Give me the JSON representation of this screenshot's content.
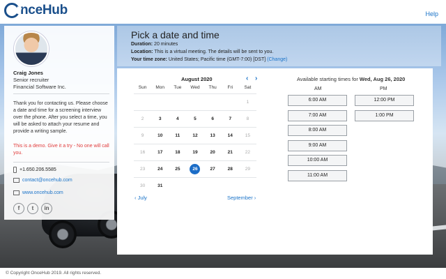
{
  "header": {
    "logo_text": "nceHub",
    "help_label": "Help"
  },
  "profile": {
    "name": "Craig Jones",
    "role": "Senior recruiter",
    "company": "Financial Software Inc.",
    "message": "Thank you for contacting us. Please choose a date and time for a screening interview over the phone. After you select a time, you will be asked to attach your resume and provide a writing sample.",
    "demo_note": "This is a demo. Give it a try - No one will call you.",
    "phone": "+1.650.206.5585",
    "email": "contact@oncehub.com",
    "website": "www.oncehub.com",
    "social": [
      "f",
      "t",
      "in"
    ]
  },
  "booking": {
    "title": "Pick a date and time",
    "duration_label": "Duration:",
    "duration_value": " 20 minutes",
    "location_label": "Location:",
    "location_value": " This is a virtual meeting. The details will be sent to you.",
    "timezone_label": "Your time zone:",
    "timezone_value": " United States;  Pacific time  (GMT-7:00) [DST]  ",
    "change_label": "(Change)"
  },
  "calendar": {
    "month": "August 2020",
    "weekdays": [
      "Sun",
      "Mon",
      "Tue",
      "Wed",
      "Thu",
      "Fri",
      "Sat"
    ],
    "weeks": [
      [
        [
          "",
          ""
        ],
        [
          "",
          ""
        ],
        [
          "",
          ""
        ],
        [
          "",
          ""
        ],
        [
          "",
          ""
        ],
        [
          "",
          ""
        ],
        [
          "1",
          "off"
        ]
      ],
      [
        [
          "2",
          "off"
        ],
        [
          "3",
          "on"
        ],
        [
          "4",
          "on"
        ],
        [
          "5",
          "on"
        ],
        [
          "6",
          "on"
        ],
        [
          "7",
          "on"
        ],
        [
          "8",
          "off"
        ]
      ],
      [
        [
          "9",
          "off"
        ],
        [
          "10",
          "on"
        ],
        [
          "11",
          "on"
        ],
        [
          "12",
          "on"
        ],
        [
          "13",
          "on"
        ],
        [
          "14",
          "on"
        ],
        [
          "15",
          "off"
        ]
      ],
      [
        [
          "16",
          "off"
        ],
        [
          "17",
          "on"
        ],
        [
          "18",
          "on"
        ],
        [
          "19",
          "on"
        ],
        [
          "20",
          "on"
        ],
        [
          "21",
          "on"
        ],
        [
          "22",
          "off"
        ]
      ],
      [
        [
          "23",
          "off"
        ],
        [
          "24",
          "on"
        ],
        [
          "25",
          "on"
        ],
        [
          "26",
          "sel"
        ],
        [
          "27",
          "on"
        ],
        [
          "28",
          "on"
        ],
        [
          "29",
          "off"
        ]
      ],
      [
        [
          "30",
          "off"
        ],
        [
          "31",
          "on"
        ],
        [
          "",
          ""
        ],
        [
          "",
          ""
        ],
        [
          "",
          ""
        ],
        [
          "",
          ""
        ],
        [
          "",
          ""
        ]
      ]
    ],
    "prev_label": "July",
    "next_label": "September"
  },
  "availability": {
    "title_prefix": "Available starting times for ",
    "title_date": "Wed, Aug 26, 2020",
    "am_label": "AM",
    "pm_label": "PM",
    "am_slots": [
      "6:00 AM",
      "7:00 AM",
      "8:00 AM",
      "9:00 AM",
      "10:00 AM",
      "11:00 AM"
    ],
    "pm_slots": [
      "12:00 PM",
      "1:00 PM"
    ]
  },
  "footer": {
    "copyright": "© Copyright OnceHub 2019. All rights reserved."
  }
}
